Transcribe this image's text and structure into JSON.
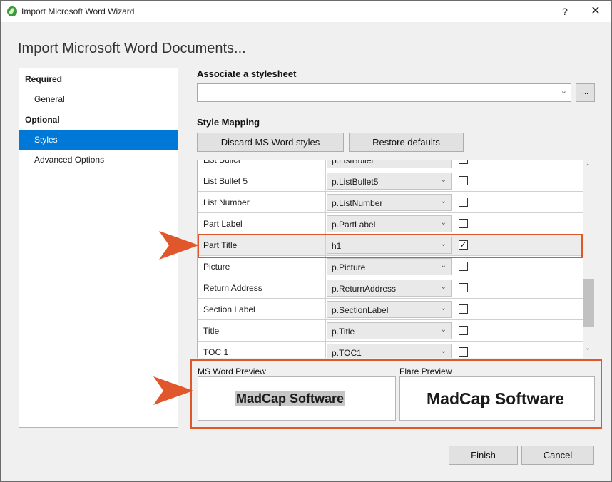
{
  "window": {
    "title": "Import Microsoft Word Wizard",
    "help_label": "?",
    "close_label": "✕"
  },
  "heading": "Import Microsoft Word Documents...",
  "nav": {
    "required_label": "Required",
    "general_label": "General",
    "optional_label": "Optional",
    "styles_label": "Styles",
    "advanced_label": "Advanced Options",
    "selected": "Styles"
  },
  "stylesheet": {
    "label": "Associate a stylesheet",
    "value": "",
    "browse_label": "..."
  },
  "style_mapping": {
    "label": "Style Mapping",
    "discard_label": "Discard MS Word styles",
    "restore_label": "Restore defaults",
    "rows": [
      {
        "name": "List Bullet",
        "style": "p.ListBullet",
        "checked": false
      },
      {
        "name": "List Bullet 5",
        "style": "p.ListBullet5",
        "checked": false
      },
      {
        "name": "List Number",
        "style": "p.ListNumber",
        "checked": false
      },
      {
        "name": "Part Label",
        "style": "p.PartLabel",
        "checked": false
      },
      {
        "name": "Part Title",
        "style": "h1",
        "checked": true,
        "selected": true
      },
      {
        "name": "Picture",
        "style": "p.Picture",
        "checked": false
      },
      {
        "name": "Return Address",
        "style": "p.ReturnAddress",
        "checked": false
      },
      {
        "name": "Section Label",
        "style": "p.SectionLabel",
        "checked": false
      },
      {
        "name": "Title",
        "style": "p.Title",
        "checked": false
      },
      {
        "name": "TOC 1",
        "style": "p.TOC1",
        "checked": false
      }
    ]
  },
  "preview": {
    "ms_label": "MS Word Preview",
    "ms_text": "MadCap Software",
    "flare_label": "Flare Preview",
    "flare_text": "MadCap Software"
  },
  "buttons": {
    "finish_label": "Finish",
    "cancel_label": "Cancel"
  },
  "colors": {
    "accent": "#0078d7",
    "callout": "#e0572b"
  },
  "icons": {
    "app": "flare-app-icon",
    "combo": "chevron-down-icon",
    "scroll_up": "chevron-up-icon",
    "scroll_down": "chevron-down-icon",
    "callout": "arrow-right-icon"
  }
}
